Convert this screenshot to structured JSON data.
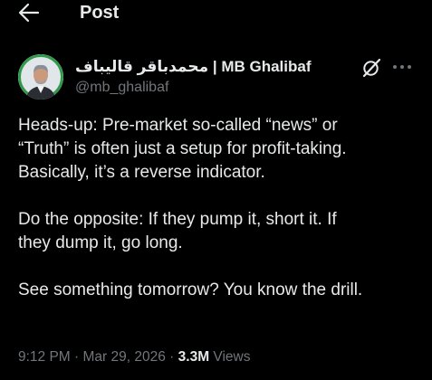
{
  "header": {
    "title": "Post",
    "back_icon": "arrow-left-icon"
  },
  "author": {
    "name_persian": "محمدباقر قالیباف",
    "name_separator": " | ",
    "name_latin": "MB Ghalibaf",
    "handle": "@mb_ghalibaf",
    "avatar_icon": "profile-photo",
    "grok_icon": "grok-icon",
    "more_icon": "more-horizontal-icon"
  },
  "tweet": {
    "paragraph1": [
      "Heads-up: Pre-market so-called “news” or",
      "“Truth” is often just a setup for profit-taking.",
      "Basically, it’s a reverse indicator."
    ],
    "paragraph2": [
      "Do the opposite: If they pump it, short it. If",
      "they dump it, go long."
    ],
    "paragraph3": [
      "See something tomorrow? You know the drill."
    ]
  },
  "meta": {
    "time": "9:12 PM",
    "dot": " · ",
    "date": "Mar 29, 2026",
    "views_count": "3.3M",
    "views_label": " Views"
  },
  "colors": {
    "background": "#000000",
    "text_primary": "#e7e9ea",
    "text_secondary": "#71767b"
  }
}
